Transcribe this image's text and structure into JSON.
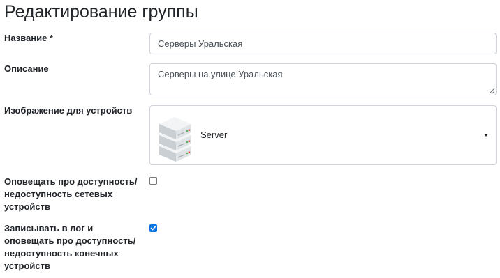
{
  "page": {
    "title": "Редактирование группы"
  },
  "form": {
    "name": {
      "label": "Название *",
      "value": "Серверы Уральская"
    },
    "description": {
      "label": "Описание",
      "value": "Серверы на улице Уральская"
    },
    "device_image": {
      "label": "Изображение для устройств",
      "selected": "Server",
      "icon": "server-icon"
    },
    "notify_network": {
      "label": "Оповещать про доступность/недоступность сетевых устройств",
      "checked": false
    },
    "log_endpoints": {
      "label": "Записывать в лог и оповещать про доступность/недоступность конечных устройств",
      "checked": true
    }
  },
  "colors": {
    "border": "#ced4da",
    "checkbox_checked": "#0b74de",
    "text": "#212529",
    "input_text": "#495057"
  }
}
